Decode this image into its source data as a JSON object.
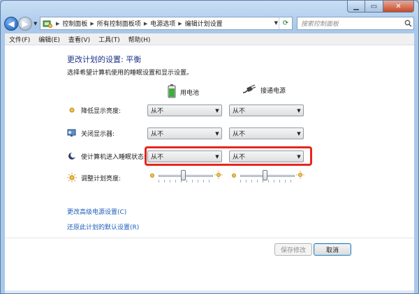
{
  "window": {
    "breadcrumbs": [
      "控制面板",
      "所有控制面板项",
      "电源选项",
      "编辑计划设置"
    ],
    "search_placeholder": "搜索控制面板"
  },
  "menu": [
    "文件(F)",
    "编辑(E)",
    "查看(V)",
    "工具(T)",
    "帮助(H)"
  ],
  "page": {
    "title": "更改计划的设置: 平衡",
    "subtitle": "选择希望计算机使用的睡眠设置和显示设置。",
    "col_battery": "用电池",
    "col_plugged": "接通电源"
  },
  "settings": [
    {
      "label": "降低显示亮度:",
      "battery": "从不",
      "plugged": "从不"
    },
    {
      "label": "关闭显示器:",
      "battery": "从不",
      "plugged": "从不"
    },
    {
      "label": "使计算机进入睡眠状态:",
      "battery": "从不",
      "plugged": "从不"
    }
  ],
  "brightness": {
    "label": "调整计划亮度:",
    "battery_level": 0.45,
    "plugged_level": 0.45
  },
  "links": {
    "advanced": "更改高级电源设置(C)",
    "restore": "还原此计划的默认设置(R)"
  },
  "buttons": {
    "save": "保存修改",
    "cancel": "取消"
  },
  "colors": {
    "title": "#1e3287",
    "link": "#1d5fbb",
    "highlight": "#e8261c"
  }
}
